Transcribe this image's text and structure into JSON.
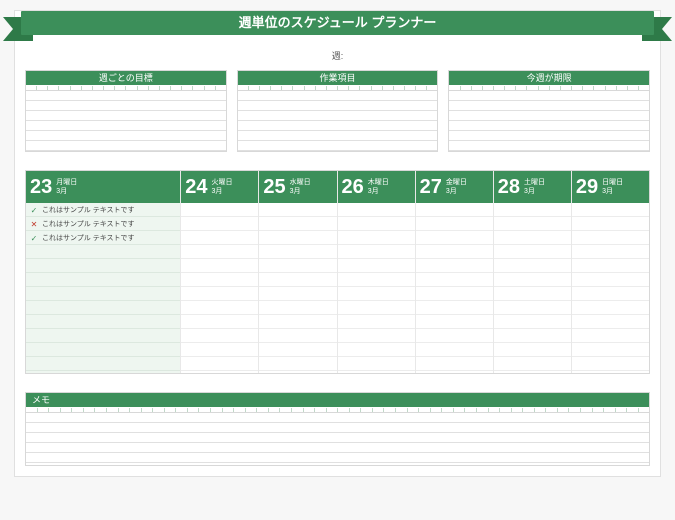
{
  "header": {
    "title": "週単位のスケジュール プランナー",
    "week_label": "週:"
  },
  "top_boxes": [
    {
      "title": "週ごとの目標"
    },
    {
      "title": "作業項目"
    },
    {
      "title": "今週が期限"
    }
  ],
  "days": [
    {
      "num": "23",
      "dow": "月曜日",
      "month": "3月"
    },
    {
      "num": "24",
      "dow": "火曜日",
      "month": "3月"
    },
    {
      "num": "25",
      "dow": "水曜日",
      "month": "3月"
    },
    {
      "num": "26",
      "dow": "木曜日",
      "month": "3月"
    },
    {
      "num": "27",
      "dow": "金曜日",
      "month": "3月"
    },
    {
      "num": "28",
      "dow": "土曜日",
      "month": "3月"
    },
    {
      "num": "29",
      "dow": "日曜日",
      "month": "3月"
    }
  ],
  "tasks": [
    {
      "status": "ok",
      "mark": "✓",
      "text": "これはサンプル テキストです"
    },
    {
      "status": "no",
      "mark": "✕",
      "text": "これはサンプル テキストです"
    },
    {
      "status": "ok",
      "mark": "✓",
      "text": "これはサンプル テキストです"
    }
  ],
  "memo": {
    "title": "メモ"
  }
}
